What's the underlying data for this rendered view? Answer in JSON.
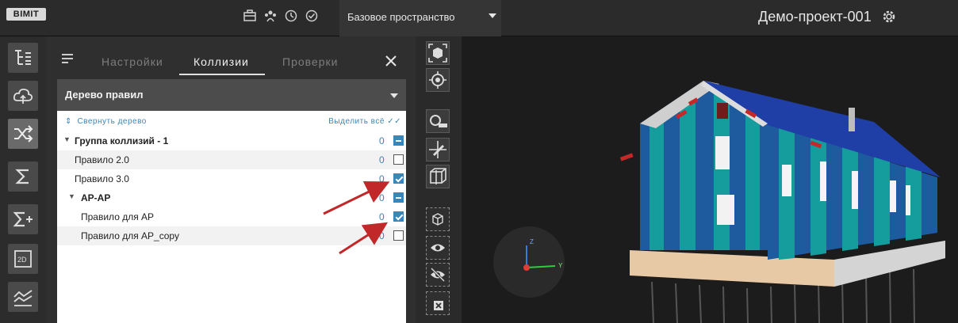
{
  "topbar": {
    "logo": "BIMIT",
    "workspace": "Базовое пространство",
    "project": "Демо-проект-001",
    "icons": [
      "briefcase-icon",
      "users-icon",
      "clock-icon",
      "check-circle-icon"
    ]
  },
  "leftbar": {
    "buttons": [
      "tree-icon",
      "cloud-icon",
      "shuffle-icon",
      "sigma-icon",
      "sigma-plus-icon",
      "2d-icon",
      "chart-icon"
    ]
  },
  "panel": {
    "tabs": [
      "Настройки",
      "Коллизии",
      "Проверки"
    ],
    "active_tab": "Коллизии",
    "dropdown": "Дерево правил",
    "collapse_link": "Свернуть дерево",
    "select_all": "Выделить всё",
    "rows": [
      {
        "name": "Группа коллизий - 1",
        "count": "0",
        "state": "indeterminate"
      },
      {
        "name": "Правило 2.0",
        "count": "0",
        "state": "unchecked"
      },
      {
        "name": "Правило 3.0",
        "count": "0",
        "state": "checked"
      },
      {
        "name": "АР-АР",
        "count": "0",
        "state": "indeterminate"
      },
      {
        "name": "Правило для АР",
        "count": "0",
        "state": "checked"
      },
      {
        "name": "Правило для АР_copy",
        "count": "0",
        "state": "unchecked"
      }
    ]
  },
  "viewport": {
    "axis_labels": [
      "Z",
      "Y"
    ]
  },
  "colors": {
    "accent": "#3a86b8",
    "annotation": "#c0282a",
    "roof": "#1f3fa6",
    "wall_teal": "#149a9a"
  }
}
